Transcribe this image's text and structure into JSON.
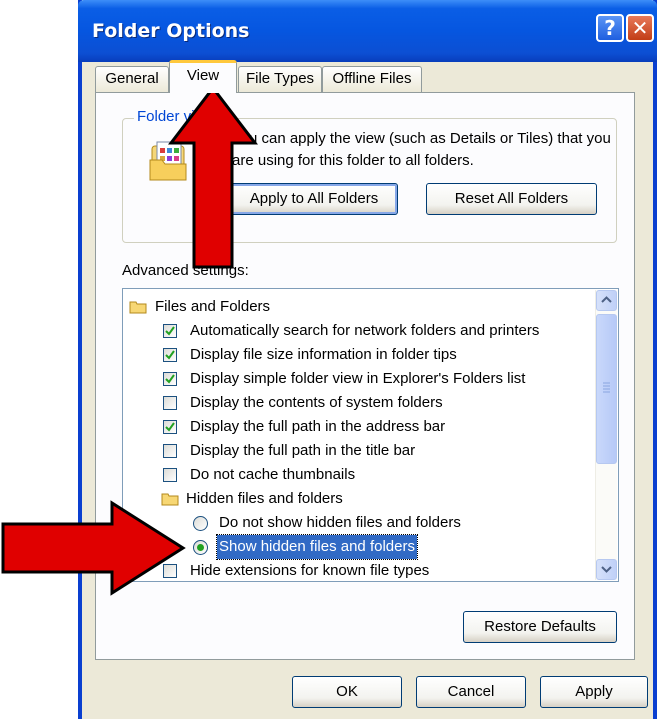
{
  "window": {
    "title": "Folder Options",
    "help_label": "?",
    "close_label": "✕"
  },
  "tabs": [
    {
      "label": "General",
      "active": false
    },
    {
      "label": "View",
      "active": true
    },
    {
      "label": "File Types",
      "active": false
    },
    {
      "label": "Offline Files",
      "active": false
    }
  ],
  "folder_views": {
    "legend": "Folder vi",
    "description": "You can apply the view (such as Details or Tiles) that you are using for this folder to all folders.",
    "apply_all_label": "Apply to All Folders",
    "reset_all_label": "Reset All Folders"
  },
  "advanced": {
    "label": "Advanced settings:",
    "items": [
      {
        "type": "folder",
        "label": "Files and Folders"
      },
      {
        "type": "checkbox",
        "checked": true,
        "label": "Automatically search for network folders and printers"
      },
      {
        "type": "checkbox",
        "checked": true,
        "label": "Display file size information in folder tips"
      },
      {
        "type": "checkbox",
        "checked": true,
        "label": "Display simple folder view in Explorer's Folders list"
      },
      {
        "type": "checkbox",
        "checked": false,
        "label": "Display the contents of system folders"
      },
      {
        "type": "checkbox",
        "checked": true,
        "label": "Display the full path in the address bar"
      },
      {
        "type": "checkbox",
        "checked": false,
        "label": "Display the full path in the title bar"
      },
      {
        "type": "checkbox",
        "checked": false,
        "label": "Do not cache thumbnails"
      },
      {
        "type": "folder",
        "label": "Hidden files and folders"
      },
      {
        "type": "radio",
        "checked": false,
        "label": "Do not show hidden files and folders"
      },
      {
        "type": "radio",
        "checked": true,
        "selected": true,
        "label": "Show hidden files and folders"
      },
      {
        "type": "checkbox",
        "checked": false,
        "label": "Hide extensions for known file types"
      }
    ]
  },
  "buttons": {
    "restore_defaults": "Restore Defaults",
    "ok": "OK",
    "cancel": "Cancel",
    "apply": "Apply"
  },
  "colors": {
    "titlebar": "#0a5ee6",
    "annotation_arrow": "#e00000",
    "selection": "#316ac5"
  }
}
